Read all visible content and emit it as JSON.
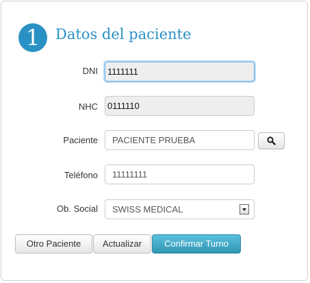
{
  "header": {
    "step_number": "1",
    "title": "Datos del paciente"
  },
  "form": {
    "dni": {
      "label": "DNI",
      "value": "1111111"
    },
    "nhc": {
      "label": "NHC",
      "value": "0111110"
    },
    "paciente": {
      "label": "Paciente",
      "value": "PACIENTE PRUEBA"
    },
    "telefono": {
      "label": "Teléfono",
      "value": "11111111"
    },
    "obra_social": {
      "label": "Ob. Social",
      "value": "SWISS MEDICAL"
    }
  },
  "buttons": {
    "otro_paciente": "Otro Paciente",
    "actualizar": "Actualizar",
    "confirmar": "Confirmar Turno"
  },
  "colors": {
    "accent": "#2a91c4",
    "primary_button": "#3aa9cb"
  }
}
